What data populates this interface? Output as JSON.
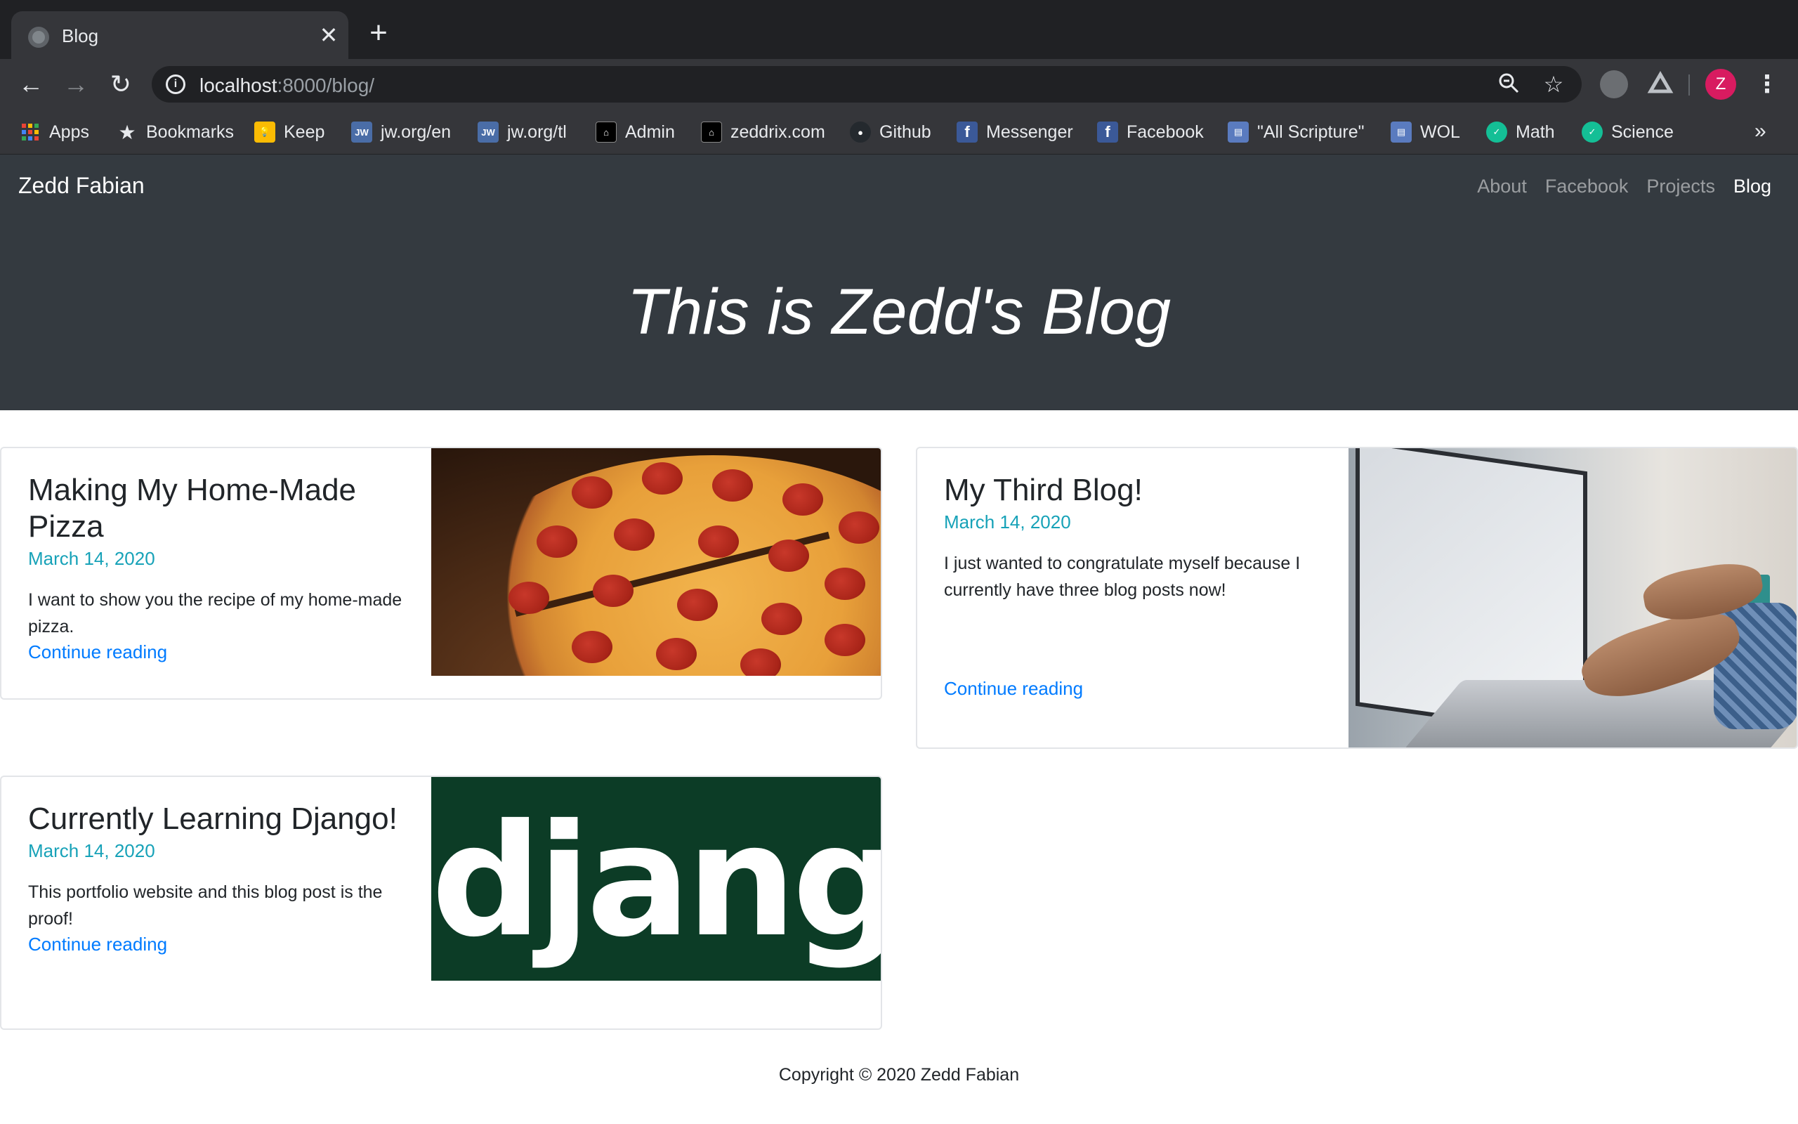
{
  "browser": {
    "tab_title": "Blog",
    "tab_close": "✕",
    "new_tab": "+",
    "url_host": "localhost",
    "url_rest": ":8000/blog/",
    "profile_initial": "Z",
    "bookmarks_overflow": "»",
    "bookmarks": [
      {
        "label": "Apps",
        "icon": "apps-grid-icon"
      },
      {
        "label": "Bookmarks",
        "icon": "star-icon"
      },
      {
        "label": "Keep",
        "icon": "keep-icon"
      },
      {
        "label": "jw.org/en",
        "icon": "jw-icon"
      },
      {
        "label": "jw.org/tl",
        "icon": "jw-icon"
      },
      {
        "label": "Admin",
        "icon": "admin-icon"
      },
      {
        "label": "zeddrix.com",
        "icon": "admin-icon"
      },
      {
        "label": "Github",
        "icon": "github-icon"
      },
      {
        "label": "Messenger",
        "icon": "facebook-icon"
      },
      {
        "label": "Facebook",
        "icon": "facebook-icon"
      },
      {
        "label": "\"All Scripture\"",
        "icon": "wol-icon"
      },
      {
        "label": "WOL",
        "icon": "wol-icon"
      },
      {
        "label": "Math",
        "icon": "khan-icon"
      },
      {
        "label": "Science",
        "icon": "khan-icon"
      }
    ]
  },
  "site": {
    "brand": "Zedd Fabian",
    "nav": [
      "About",
      "Facebook",
      "Projects",
      "Blog"
    ],
    "active_nav": "Blog",
    "hero_title": "This is Zedd's Blog",
    "footer": "Copyright © 2020 Zedd Fabian"
  },
  "posts": [
    {
      "title": "Making My Home-Made Pizza",
      "date": "March 14, 2020",
      "summary": "I want to show you the recipe of my home-made pizza.",
      "link": "Continue reading",
      "image": "pizza"
    },
    {
      "title": "My Third Blog!",
      "date": "March 14, 2020",
      "summary": "I just wanted to congratulate myself because I currently have three blog posts now!",
      "link": "Continue reading",
      "image": "laptop"
    },
    {
      "title": "Currently Learning Django!",
      "date": "March 14, 2020",
      "summary": "This portfolio website and this blog post is the proof!",
      "link": "Continue reading",
      "image": "django",
      "image_text": "django"
    }
  ],
  "colors": {
    "navbar": "#343a40",
    "date": "#17a2b8",
    "link": "#007bff",
    "django_green": "#0c3c26"
  }
}
